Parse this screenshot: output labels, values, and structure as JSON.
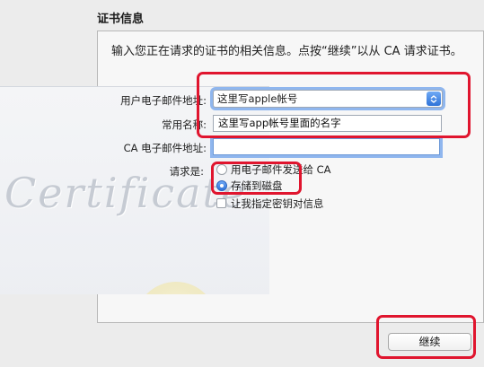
{
  "section_title": "证书信息",
  "intro_text": "输入您正在请求的证书的相关信息。点按“继续”以从 CA 请求证书。",
  "watermark_text": "Certificate",
  "form": {
    "email_label": "用户电子邮件地址:",
    "email_value": "这里写apple帐号",
    "name_label": "常用名称:",
    "name_value": "这里写app帐号里面的名字",
    "ca_email_label": "CA 电子邮件地址:",
    "ca_email_value": "",
    "request_label": "请求是:",
    "option_email": "用电子邮件发送给 CA",
    "option_save": "存储到磁盘",
    "option_keypair": "让我指定密钥对信息",
    "selected_option": "option_save"
  },
  "continue_label": "继续",
  "colors": {
    "focus_ring": "#8fb6ee",
    "annotation": "#e0152e",
    "accent": "#2f73d8"
  },
  "icons": {
    "dropdown": "chevron-up-down-icon"
  }
}
